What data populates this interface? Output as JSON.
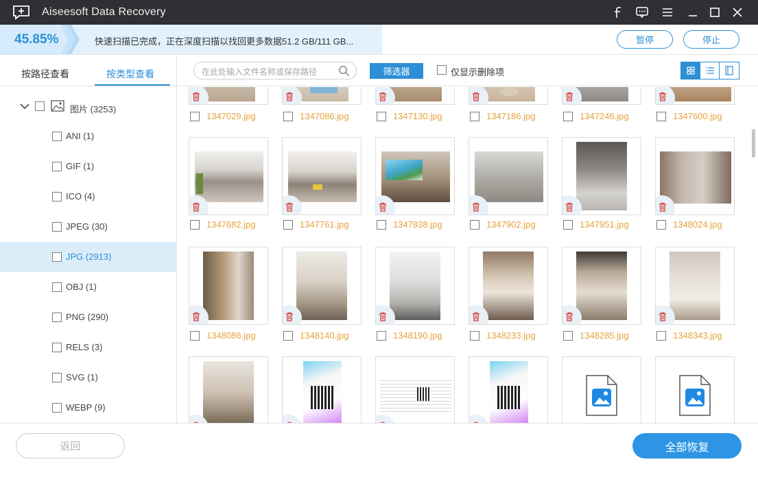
{
  "window": {
    "title": "Aiseesoft Data Recovery"
  },
  "progress": {
    "percent_label": "45.85%",
    "fraction": 0.4585,
    "message": "快速扫描已完成，正在深度扫描以找回更多数据51.2 GB/111 GB...",
    "pause_label": "暂停",
    "stop_label": "停止"
  },
  "sidebar": {
    "tab_path": "按路径查看",
    "tab_type": "按类型查看",
    "root": {
      "label": "图片 (3253)"
    },
    "items": [
      {
        "label": "ANI (1)"
      },
      {
        "label": "GIF (1)"
      },
      {
        "label": "ICO (4)"
      },
      {
        "label": "JPEG (30)"
      },
      {
        "label": "JPG (2913)",
        "selected": true
      },
      {
        "label": "OBJ (1)"
      },
      {
        "label": "PNG (290)"
      },
      {
        "label": "RELS (3)"
      },
      {
        "label": "SVG (1)"
      },
      {
        "label": "WEBP (9)"
      }
    ]
  },
  "toolbar": {
    "search_placeholder": "在此处输入文件名称或保存路径",
    "filter_label": "筛选器",
    "only_deleted_label": "仅显示删除项"
  },
  "files": {
    "row0": [
      "1347029.jpg",
      "1347086.jpg",
      "1347130.jpg",
      "1347186.jpg",
      "1347246.jpg",
      "1347600.jpg"
    ],
    "row1": [
      "1347682.jpg",
      "1347761.jpg",
      "1347838.jpg",
      "1347902.jpg",
      "1347951.jpg",
      "1348024.jpg"
    ],
    "row2": [
      "1348086.jpg",
      "1348140.jpg",
      "1348190.jpg",
      "1348233.jpg",
      "1348285.jpg",
      "1348343.jpg"
    ]
  },
  "footer": {
    "back_label": "返回",
    "recover_label": "全部恢复"
  },
  "colors": {
    "accent": "#2d8fd5",
    "filename": "#e6a23c",
    "delete_icon": "#d9534f",
    "titlebar": "#2f3033"
  }
}
